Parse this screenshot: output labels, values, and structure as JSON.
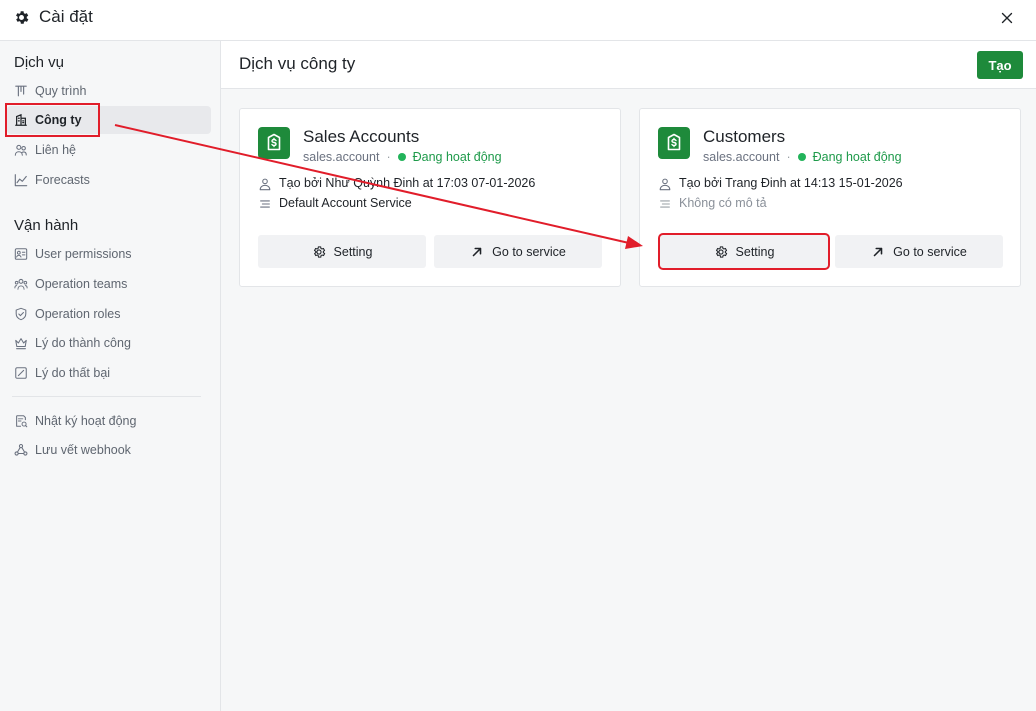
{
  "window": {
    "title": "Cài đặt"
  },
  "sidebar": {
    "sections": [
      {
        "title": "Dịch vụ",
        "items": [
          {
            "label": "Quy trình",
            "icon": "workflow-icon"
          },
          {
            "label": "Công ty",
            "icon": "company-icon",
            "active": true
          },
          {
            "label": "Liên hệ",
            "icon": "contacts-icon"
          },
          {
            "label": "Forecasts",
            "icon": "chart-line-icon"
          }
        ]
      },
      {
        "title": "Vận hành",
        "items": [
          {
            "label": "User permissions",
            "icon": "user-permission-icon"
          },
          {
            "label": "Operation teams",
            "icon": "team-icon"
          },
          {
            "label": "Operation roles",
            "icon": "shield-icon"
          },
          {
            "label": "Lý do thành công",
            "icon": "crown-icon"
          },
          {
            "label": "Lý do thất bại",
            "icon": "slash-box-icon"
          }
        ]
      },
      {
        "title": "",
        "items": [
          {
            "label": "Nhật ký hoạt động",
            "icon": "log-icon"
          },
          {
            "label": "Lưu vết webhook",
            "icon": "webhook-icon"
          }
        ]
      }
    ]
  },
  "main": {
    "title": "Dịch vụ công ty",
    "create_label": "Tạo",
    "cards": [
      {
        "name": "Sales Accounts",
        "code": "sales.account",
        "separator": "·",
        "status": "Đang hoạt động",
        "created": "Tạo bởi Như Quỳnh Đinh at 17:03 07-01-2026",
        "description": "Default Account Service",
        "setting_label": "Setting",
        "goto_label": "Go to service"
      },
      {
        "name": "Customers",
        "code": "sales.account",
        "separator": "·",
        "status": "Đang hoạt động",
        "created": "Tạo bởi Trang Đinh at 14:13 15-01-2026",
        "description": "Không có mô tả",
        "setting_label": "Setting",
        "goto_label": "Go to service"
      }
    ]
  },
  "colors": {
    "brand": "#1e8a3b",
    "status": "#22b35a",
    "annotation": "#e11d2a"
  }
}
